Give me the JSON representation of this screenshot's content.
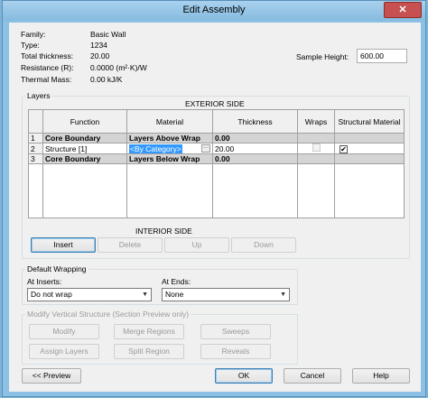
{
  "window": {
    "title": "Edit Assembly",
    "close_label": "✕"
  },
  "properties": {
    "family_label": "Family:",
    "family_value": "Basic Wall",
    "type_label": "Type:",
    "type_value": "1234",
    "thickness_label": "Total thickness:",
    "thickness_value": "20.00",
    "resistance_label": "Resistance (R):",
    "resistance_value": "0.0000 (m²·K)/W",
    "mass_label": "Thermal Mass:",
    "mass_value": "0.00 kJ/K"
  },
  "sample_height": {
    "label": "Sample Height:",
    "value": "600.00"
  },
  "layers": {
    "group_label": "Layers",
    "exterior_label": "EXTERIOR SIDE",
    "interior_label": "INTERIOR SIDE",
    "columns": [
      "Function",
      "Material",
      "Thickness",
      "Wraps",
      "Structural Material"
    ],
    "rows": [
      {
        "num": "1",
        "function": "Core Boundary",
        "material": "Layers Above Wrap",
        "thickness": "0.00"
      },
      {
        "num": "2",
        "function": "Structure [1]",
        "material": "<By Category>",
        "thickness": "20.00",
        "wraps": false,
        "structural": true
      },
      {
        "num": "3",
        "function": "Core Boundary",
        "material": "Layers Below Wrap",
        "thickness": "0.00"
      }
    ],
    "buttons": {
      "insert": "Insert",
      "delete": "Delete",
      "up": "Up",
      "down": "Down"
    }
  },
  "default_wrapping": {
    "group_label": "Default Wrapping",
    "at_inserts_label": "At Inserts:",
    "at_inserts_value": "Do not wrap",
    "at_ends_label": "At Ends:",
    "at_ends_value": "None"
  },
  "modify_structure": {
    "group_label": "Modify Vertical Structure (Section Preview only)",
    "buttons": {
      "modify": "Modify",
      "merge_regions": "Merge Regions",
      "sweeps": "Sweeps",
      "assign_layers": "Assign Layers",
      "split_region": "Split Region",
      "reveals": "Reveals"
    }
  },
  "footer": {
    "preview": "<< Preview",
    "ok": "OK",
    "cancel": "Cancel",
    "help": "Help"
  }
}
